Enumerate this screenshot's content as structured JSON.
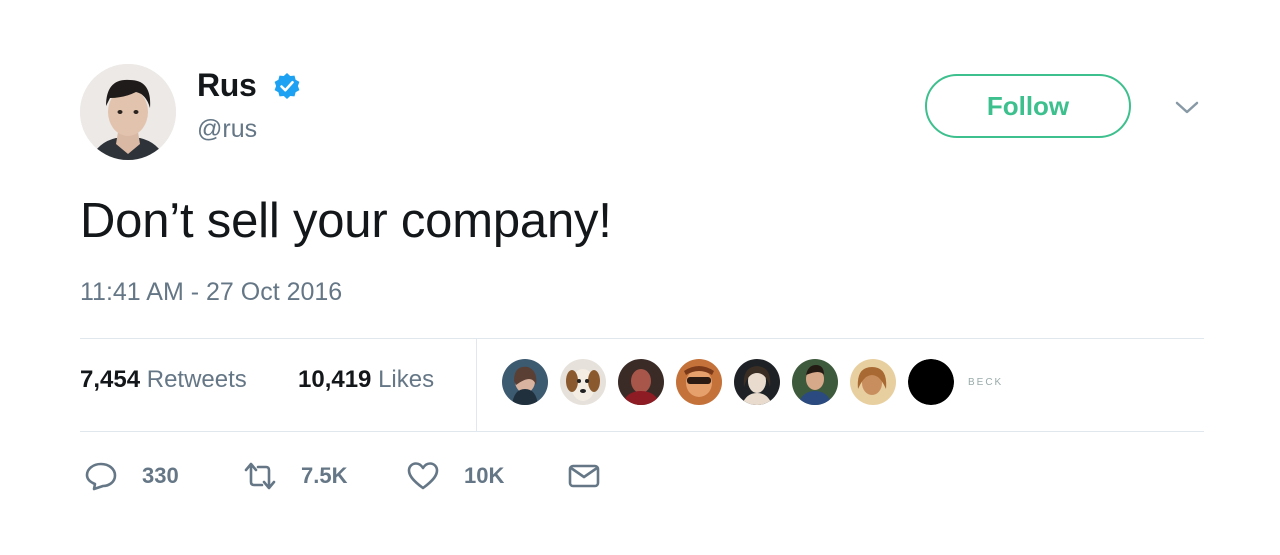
{
  "user": {
    "name": "Rus",
    "handle": "@rus",
    "verified": true
  },
  "follow_label": "Follow",
  "tweet_text": "Don’t sell your company!",
  "timestamp": "11:41 AM - 27 Oct 2016",
  "stats": {
    "retweets_count": "7,454",
    "retweets_label": "Retweets",
    "likes_count": "10,419",
    "likes_label": "Likes"
  },
  "likers_badge": "BECK",
  "actions": {
    "reply": "330",
    "retweet": "7.5K",
    "like": "10K"
  },
  "colors": {
    "follow": "#3dbf8e",
    "verified": "#1da1f2",
    "muted": "#657786"
  }
}
